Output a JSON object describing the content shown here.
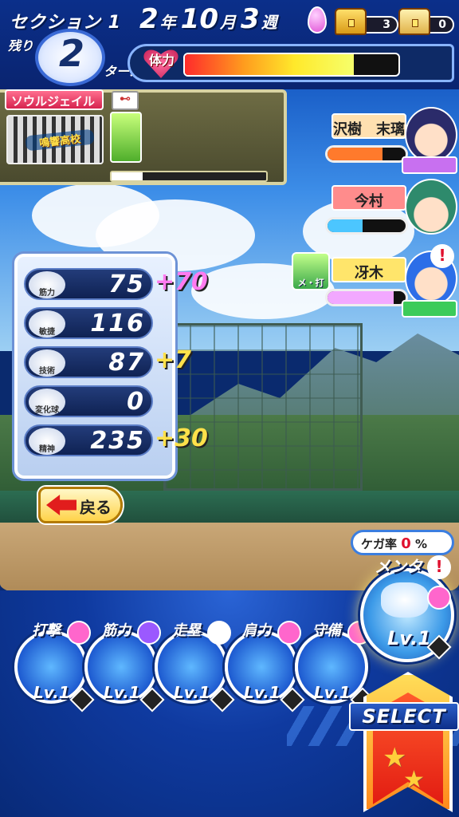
{
  "header": {
    "section_label": "セクション 1",
    "remaining_label": "残り",
    "turns_left": "2",
    "turn_label": "ターン",
    "date": {
      "year": "2",
      "year_unit": "年",
      "month": "10",
      "month_unit": "月",
      "week": "3",
      "week_unit": "週"
    },
    "chest_gold_count": "3",
    "chest_silver_count": "0",
    "stamina_label": "体力",
    "stamina_fraction": 0.79
  },
  "item": {
    "name": "ソウルジェイル",
    "school": "鳴響高校",
    "progress_fraction": 0.2
  },
  "characters": [
    {
      "name": "沢樹　末璃",
      "bar_color": "#ff7a2c",
      "bar_fraction": 0.7,
      "name_bg": "#ffe0b0",
      "tag_color": "#c870f0"
    },
    {
      "name": "今村",
      "bar_color": "#4cc6ff",
      "bar_fraction": 0.45,
      "name_bg": "#ff8c8c",
      "tag_color": "#c89c6a"
    },
    {
      "name": "冴木",
      "bar_color": "#f2a8ff",
      "bar_fraction": 0.85,
      "name_bg": "#ffe56b",
      "tag_color": "#3ccb5a",
      "badge": "メ・打"
    }
  ],
  "stats": [
    {
      "label": "筋力",
      "value": "75",
      "bonus": "+70",
      "bonus_color": "#ff7bf0"
    },
    {
      "label": "敏捷",
      "value": "116",
      "bonus": "",
      "bonus_color": "#ffe14a"
    },
    {
      "label": "技術",
      "value": "87",
      "bonus": "+7",
      "bonus_color": "#ffe14a"
    },
    {
      "label": "変化球",
      "value": "0",
      "bonus": "",
      "bonus_color": "#ffe14a"
    },
    {
      "label": "精神",
      "value": "235",
      "bonus": "+30",
      "bonus_color": "#ffe14a"
    }
  ],
  "back_label": "戻る",
  "injury": {
    "label": "ケガ率",
    "value": "0",
    "unit": "%"
  },
  "training": [
    {
      "label": "打撃",
      "lv": "Lv.1",
      "bubble": "#ff66cc"
    },
    {
      "label": "筋力",
      "lv": "Lv.1",
      "bubble": "#9b59ff"
    },
    {
      "label": "走塁",
      "lv": "Lv.1",
      "bubble": "#ffffff"
    },
    {
      "label": "肩力",
      "lv": "Lv.1",
      "bubble": "#ff66cc"
    },
    {
      "label": "守備",
      "lv": "Lv.1",
      "bubble": "#ff66cc"
    }
  ],
  "mental": {
    "label": "メンタ",
    "lv": "Lv.1"
  },
  "select_label": "SELECT"
}
